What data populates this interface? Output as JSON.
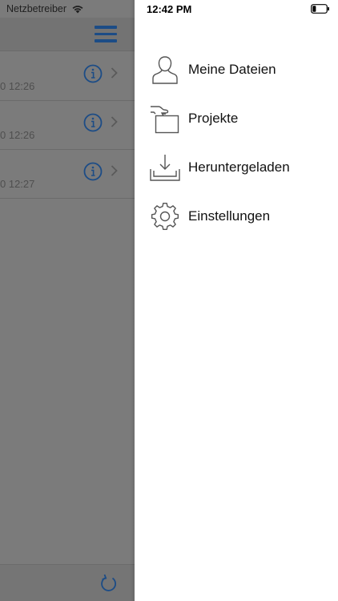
{
  "status_bar": {
    "carrier": "Netzbetreiber",
    "time": "12:42 PM",
    "battery_level": 0.25
  },
  "file_list": {
    "rows": [
      {
        "time": "0 12:26"
      },
      {
        "time": "0 12:26"
      },
      {
        "time": "0 12:27"
      }
    ]
  },
  "drawer": {
    "items": [
      {
        "label": "Meine Dateien",
        "icon": "person-icon"
      },
      {
        "label": "Projekte",
        "icon": "projects-icon"
      },
      {
        "label": "Heruntergeladen",
        "icon": "download-tray-icon"
      },
      {
        "label": "Einstellungen",
        "icon": "gear-icon"
      }
    ]
  },
  "colors": {
    "accent": "#1c4c86",
    "overlay": "#7b7b7b"
  }
}
